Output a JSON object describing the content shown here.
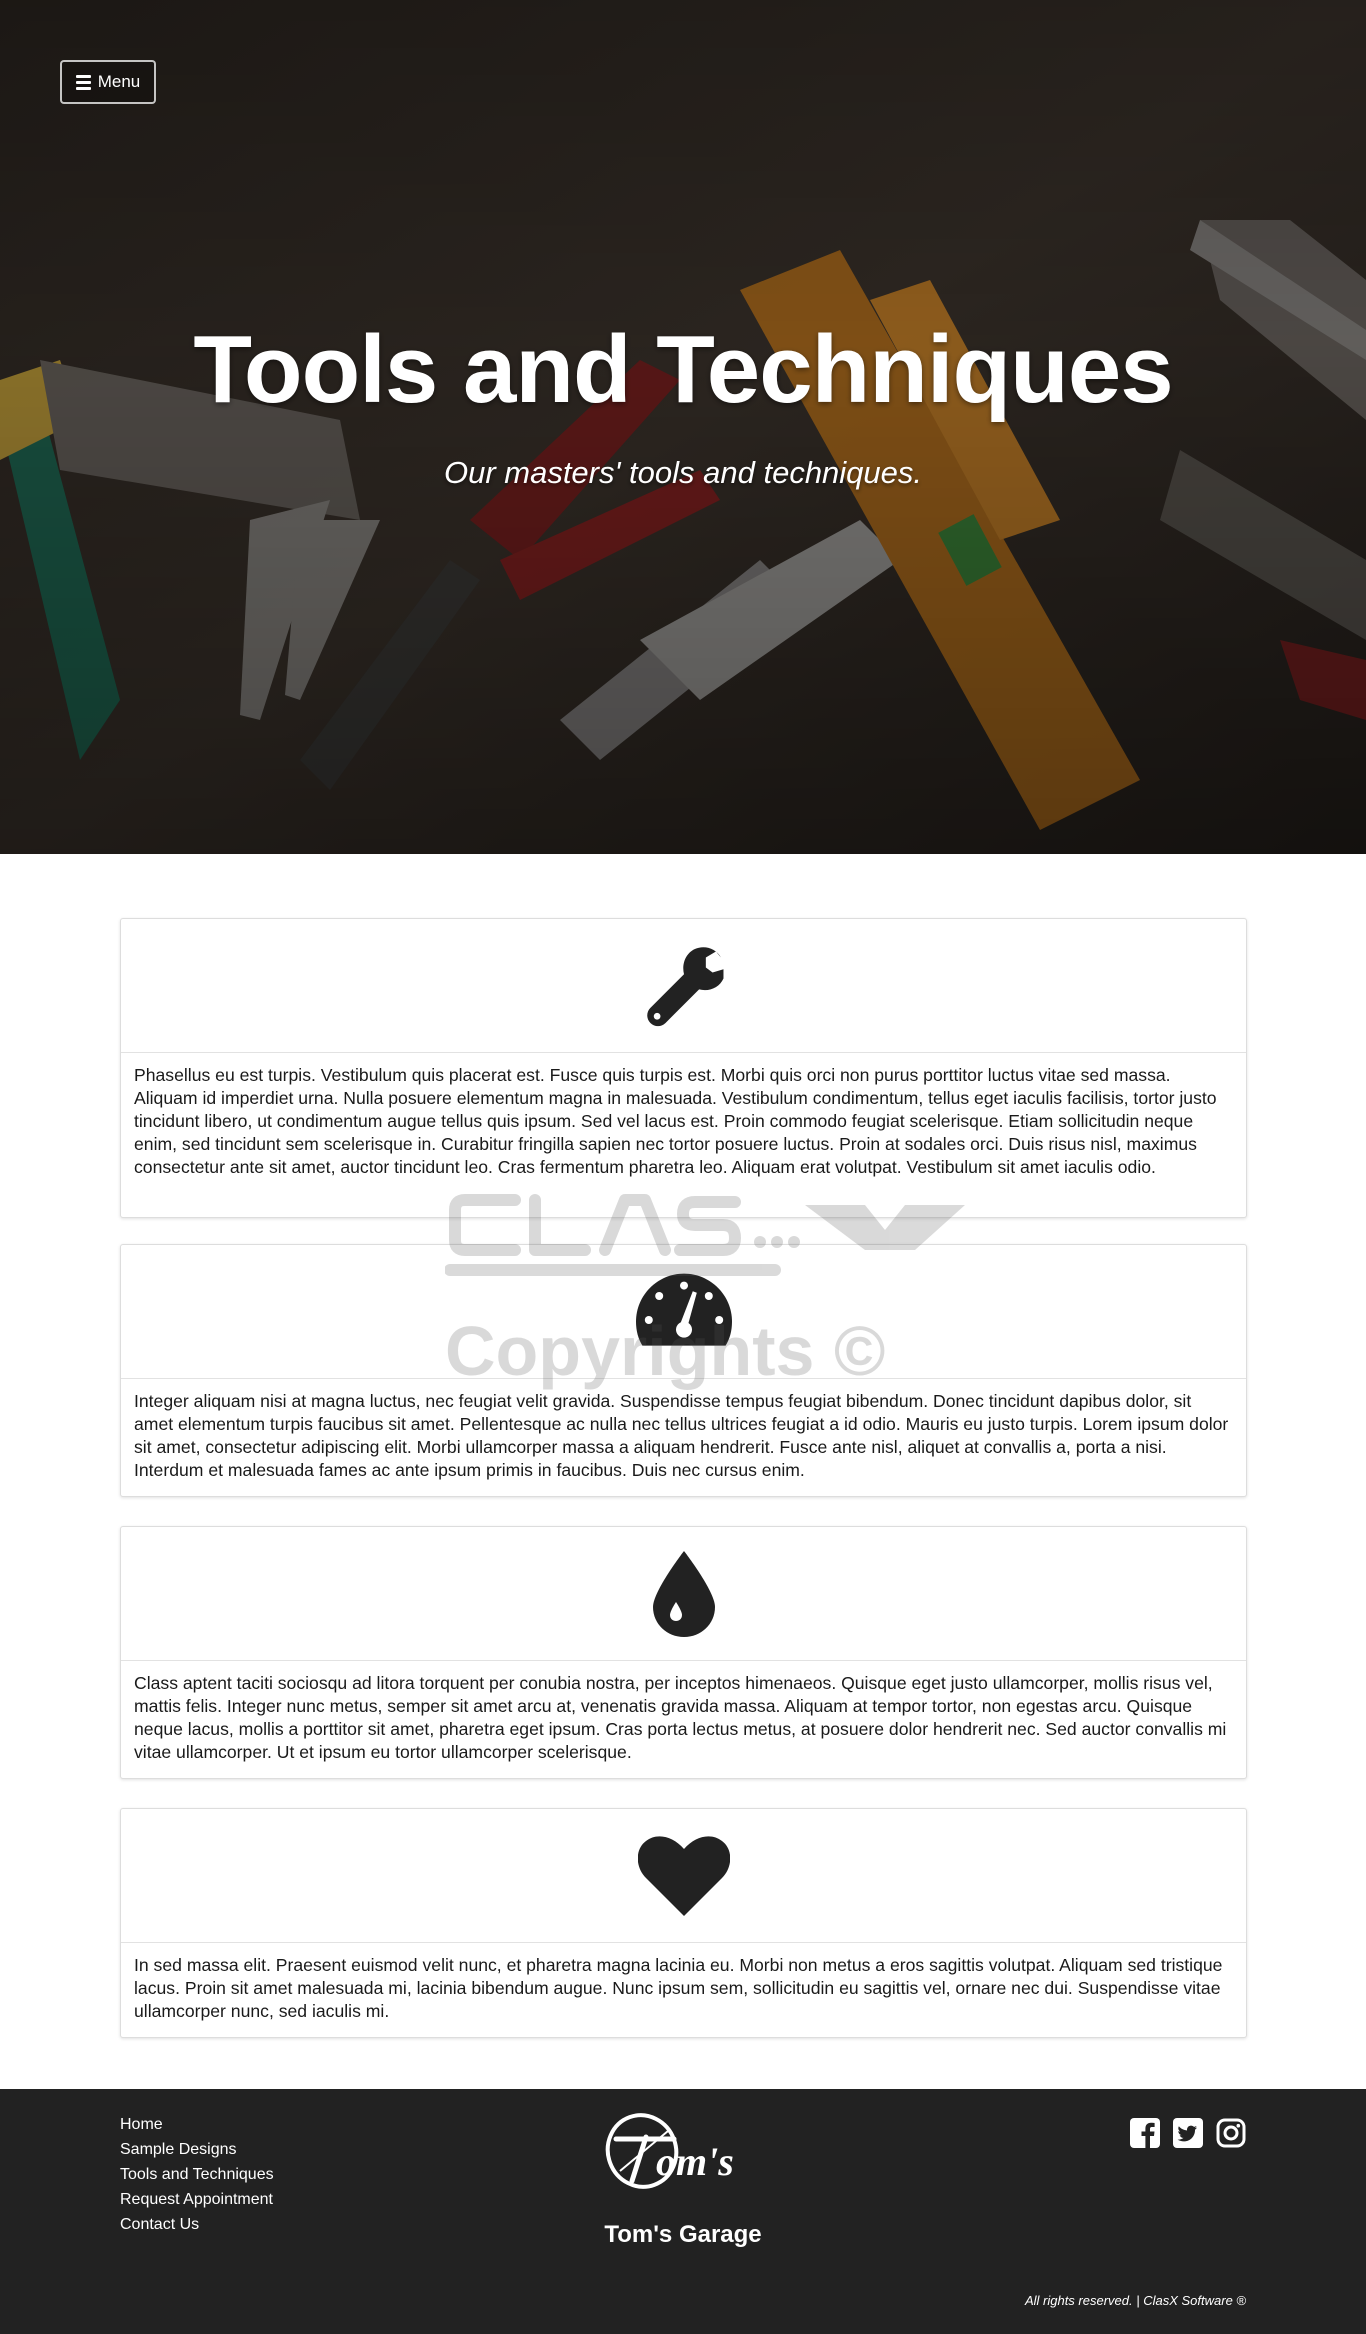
{
  "header": {
    "menu_label": "Menu",
    "menu_icon": "bars-icon"
  },
  "hero": {
    "title": "Tools and Techniques",
    "subtitle": "Our masters' tools and techniques."
  },
  "features": [
    {
      "icon": "wrench-icon",
      "text": "Phasellus eu est turpis. Vestibulum quis placerat est. Fusce quis turpis est. Morbi quis orci non purus porttitor luctus vitae sed massa. Aliquam id imperdiet urna. Nulla posuere elementum magna in malesuada. Vestibulum condimentum, tellus eget iaculis facilisis, tortor justo tincidunt libero, ut condimentum augue tellus quis ipsum. Sed vel lacus est. Proin commodo feugiat scelerisque. Etiam sollicitudin neque enim, sed tincidunt sem scelerisque in. Curabitur fringilla sapien nec tortor posuere luctus. Proin at sodales orci. Duis risus nisl, maximus consectetur ante sit amet, auctor tincidunt leo. Cras fermentum pharetra leo. Aliquam erat volutpat. Vestibulum sit amet iaculis odio."
    },
    {
      "icon": "tachometer-icon",
      "text": "Integer aliquam nisi at magna luctus, nec feugiat velit gravida. Suspendisse tempus feugiat bibendum. Donec tincidunt dapibus dolor, sit amet elementum turpis faucibus sit amet. Pellentesque ac nulla nec tellus ultrices feugiat a id odio. Mauris eu justo turpis. Lorem ipsum dolor sit amet, consectetur adipiscing elit. Morbi ullamcorper massa a aliquam hendrerit. Fusce ante nisl, aliquet at convallis a, porta a nisi. Interdum et malesuada fames ac ante ipsum primis in faucibus. Duis nec cursus enim."
    },
    {
      "icon": "oil-drop-icon",
      "text": "Class aptent taciti sociosqu ad litora torquent per conubia nostra, per inceptos himenaeos. Quisque eget justo ullamcorper, mollis risus vel, mattis felis. Integer nunc metus, semper sit amet arcu at, venenatis gravida massa. Aliquam at tempor tortor, non egestas arcu. Quisque neque lacus, mollis a porttitor sit amet, pharetra eget ipsum. Cras porta lectus metus, at posuere dolor hendrerit nec. Sed auctor convallis mi vitae ullamcorper. Ut et ipsum eu tortor ullamcorper scelerisque."
    },
    {
      "icon": "heart-icon",
      "text": "In sed massa elit. Praesent euismod velit nunc, et pharetra magna lacinia eu. Morbi non metus a eros sagittis volutpat. Aliquam sed tristique lacus. Proin sit amet malesuada mi, lacinia bibendum augue. Nunc ipsum sem, sollicitudin eu sagittis vel, ornare nec dui. Suspendisse vitae ullamcorper nunc, sed iaculis mi."
    }
  ],
  "watermark": {
    "logo_text": "CLASX",
    "text": "Copyrights ©"
  },
  "footer": {
    "nav": [
      "Home",
      "Sample Designs",
      "Tools and Techniques",
      "Request Appointment",
      "Contact Us"
    ],
    "logo_text": "om's",
    "brand": "Tom's Garage",
    "social": [
      "facebook-icon",
      "twitter-icon",
      "instagram-icon"
    ],
    "copyright": "All rights reserved. | ClasX Software ®"
  },
  "colors": {
    "footer_bg": "#222222",
    "icon": "#222222",
    "card_border": "#dddddd"
  }
}
